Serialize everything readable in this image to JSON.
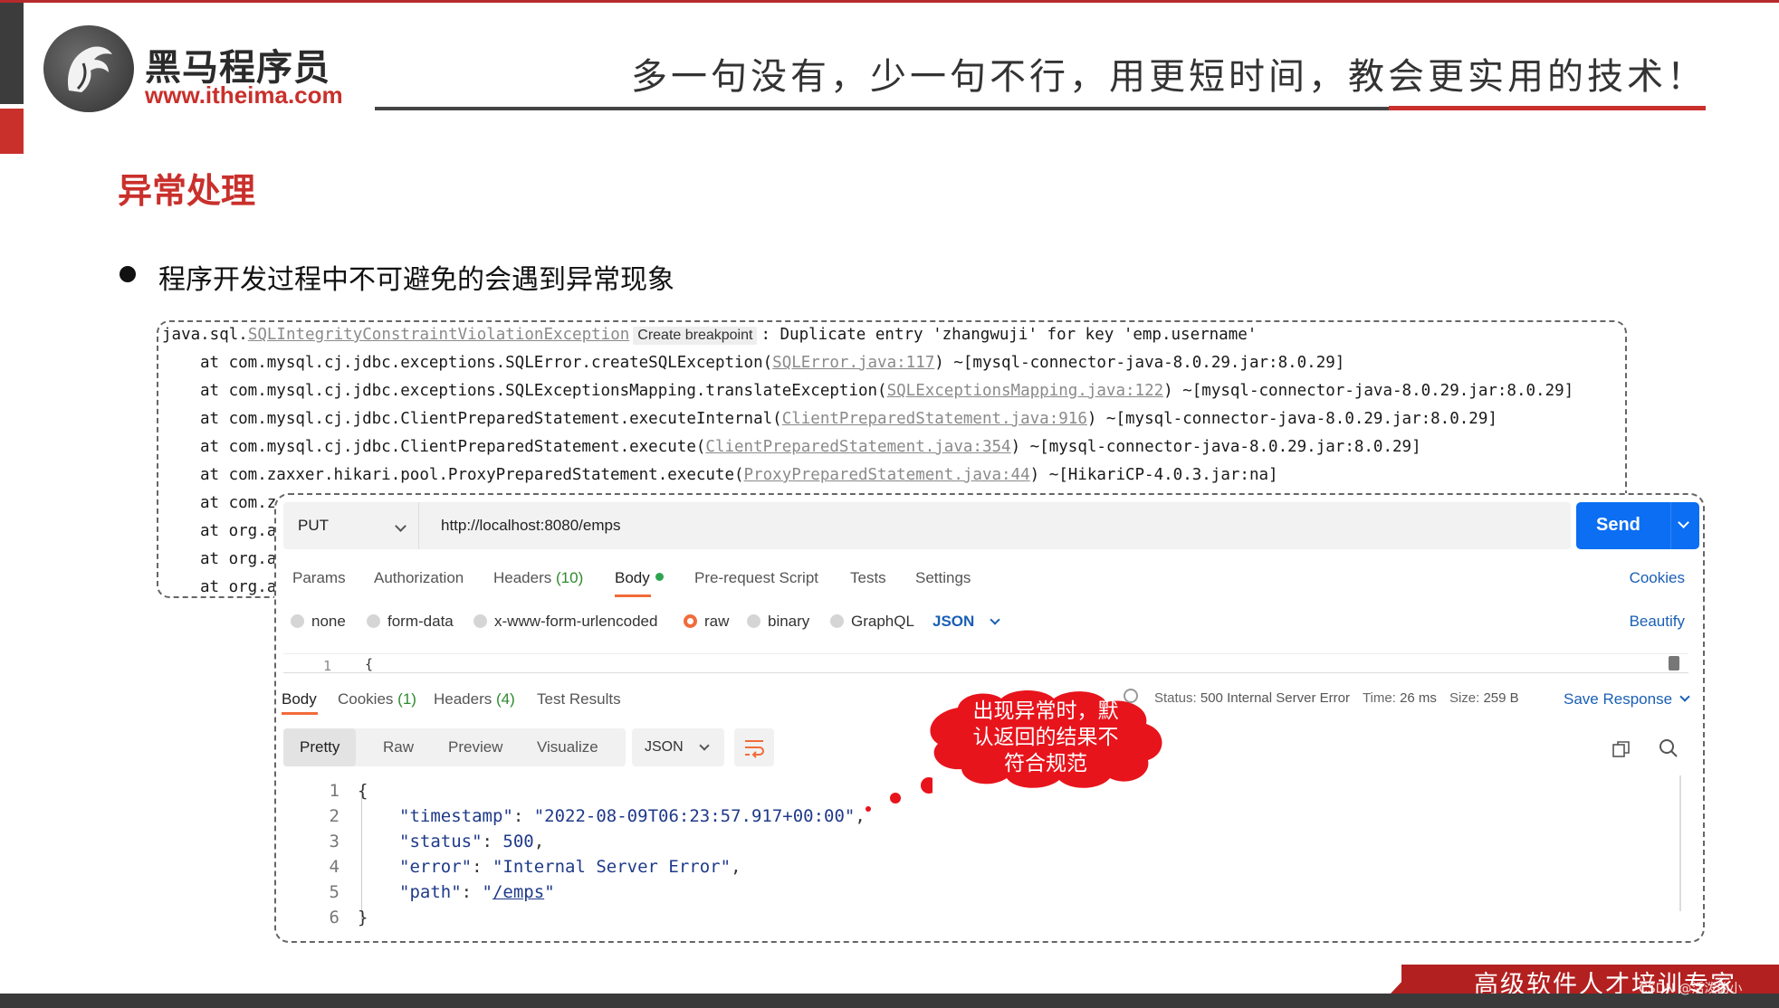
{
  "brand": {
    "name_cn": "黑马程序员",
    "url": "www.itheima.com",
    "slogan": "多一句没有，少一句不行，用更短时间，教会更实用的技术！"
  },
  "slide": {
    "title": "异常处理",
    "bullet": "程序开发过程中不可避免的会遇到异常现象"
  },
  "trace": {
    "first_prefix": "java.sql.",
    "first_class": "SQLIntegrityConstraintViolationException",
    "tooltip": "Create breakpoint",
    "first_suffix": ": Duplicate entry 'zhangwuji' for key 'emp.username'",
    "lines": [
      {
        "pre": "at com.mysql.cj.jdbc.exceptions.SQLError.createSQLException(",
        "link": "SQLError.java:117",
        "post": ") ~[mysql-connector-java-8.0.29.jar:8.0.29]"
      },
      {
        "pre": "at com.mysql.cj.jdbc.exceptions.SQLExceptionsMapping.translateException(",
        "link": "SQLExceptionsMapping.java:122",
        "post": ") ~[mysql-connector-java-8.0.29.jar:8.0.29]"
      },
      {
        "pre": "at com.mysql.cj.jdbc.ClientPreparedStatement.executeInternal(",
        "link": "ClientPreparedStatement.java:916",
        "post": ") ~[mysql-connector-java-8.0.29.jar:8.0.29]"
      },
      {
        "pre": "at com.mysql.cj.jdbc.ClientPreparedStatement.execute(",
        "link": "ClientPreparedStatement.java:354",
        "post": ") ~[mysql-connector-java-8.0.29.jar:8.0.29]"
      },
      {
        "pre": "at com.zaxxer.hikari.pool.ProxyPreparedStatement.execute(",
        "link": "ProxyPreparedStatement.java:44",
        "post": ") ~[HikariCP-4.0.3.jar:na]"
      },
      {
        "pre": "at com.z",
        "link": "",
        "post": ""
      },
      {
        "pre": "at org.a",
        "link": "",
        "post": ""
      },
      {
        "pre": "at org.a",
        "link": "",
        "post": ""
      },
      {
        "pre": "at org.a",
        "link": "",
        "post": ""
      }
    ]
  },
  "postman": {
    "method": "PUT",
    "url": "http://localhost:8080/emps",
    "send_label": "Send",
    "request_tabs": {
      "params": "Params",
      "authorization": "Authorization",
      "headers": "Headers",
      "headers_count": "(10)",
      "body": "Body",
      "prerequest": "Pre-request Script",
      "tests": "Tests",
      "settings": "Settings"
    },
    "cookies_link": "Cookies",
    "body_types": {
      "none": "none",
      "form_data": "form-data",
      "urlencoded": "x-www-form-urlencoded",
      "raw": "raw",
      "binary": "binary",
      "graphql": "GraphQL"
    },
    "body_format": "JSON",
    "beautify": "Beautify",
    "editor_line": "1",
    "editor_text": "{",
    "response_tabs": {
      "body": "Body",
      "cookies": "Cookies",
      "cookies_count": "(1)",
      "headers": "Headers",
      "headers_count": "(4)",
      "test_results": "Test Results"
    },
    "status": {
      "status_label": "Status:",
      "status_value": "500 Internal Server Error",
      "time_label": "Time:",
      "time_value": "26 ms",
      "size_label": "Size:",
      "size_value": "259 B"
    },
    "save_response": "Save Response",
    "view_modes": {
      "pretty": "Pretty",
      "raw": "Raw",
      "preview": "Preview",
      "visualize": "Visualize"
    },
    "response_format": "JSON",
    "response_json": {
      "line_numbers": [
        "1",
        "2",
        "3",
        "4",
        "5",
        "6"
      ],
      "open": "{",
      "timestamp_key": "\"timestamp\"",
      "timestamp_val": "\"2022-08-09T06:23:57.917+00:00\"",
      "status_key": "\"status\"",
      "status_val": "500",
      "error_key": "\"error\"",
      "error_val": "\"Internal Server Error\"",
      "path_key": "\"path\"",
      "path_val": "/emps",
      "close": "}"
    }
  },
  "callout": {
    "line1": "出现异常时，默",
    "line2": "认返回的结果不",
    "line3": "符合规范"
  },
  "footer": {
    "tagline": "高级软件人才培训专家",
    "watermark": "CSDN @活泼的小"
  },
  "colors": {
    "brand_red": "#c9302c",
    "send_blue": "#0b6ef3",
    "active_tab": "#f26b3a",
    "link_blue": "#1a5fb4",
    "callout_red": "#e8141c"
  }
}
